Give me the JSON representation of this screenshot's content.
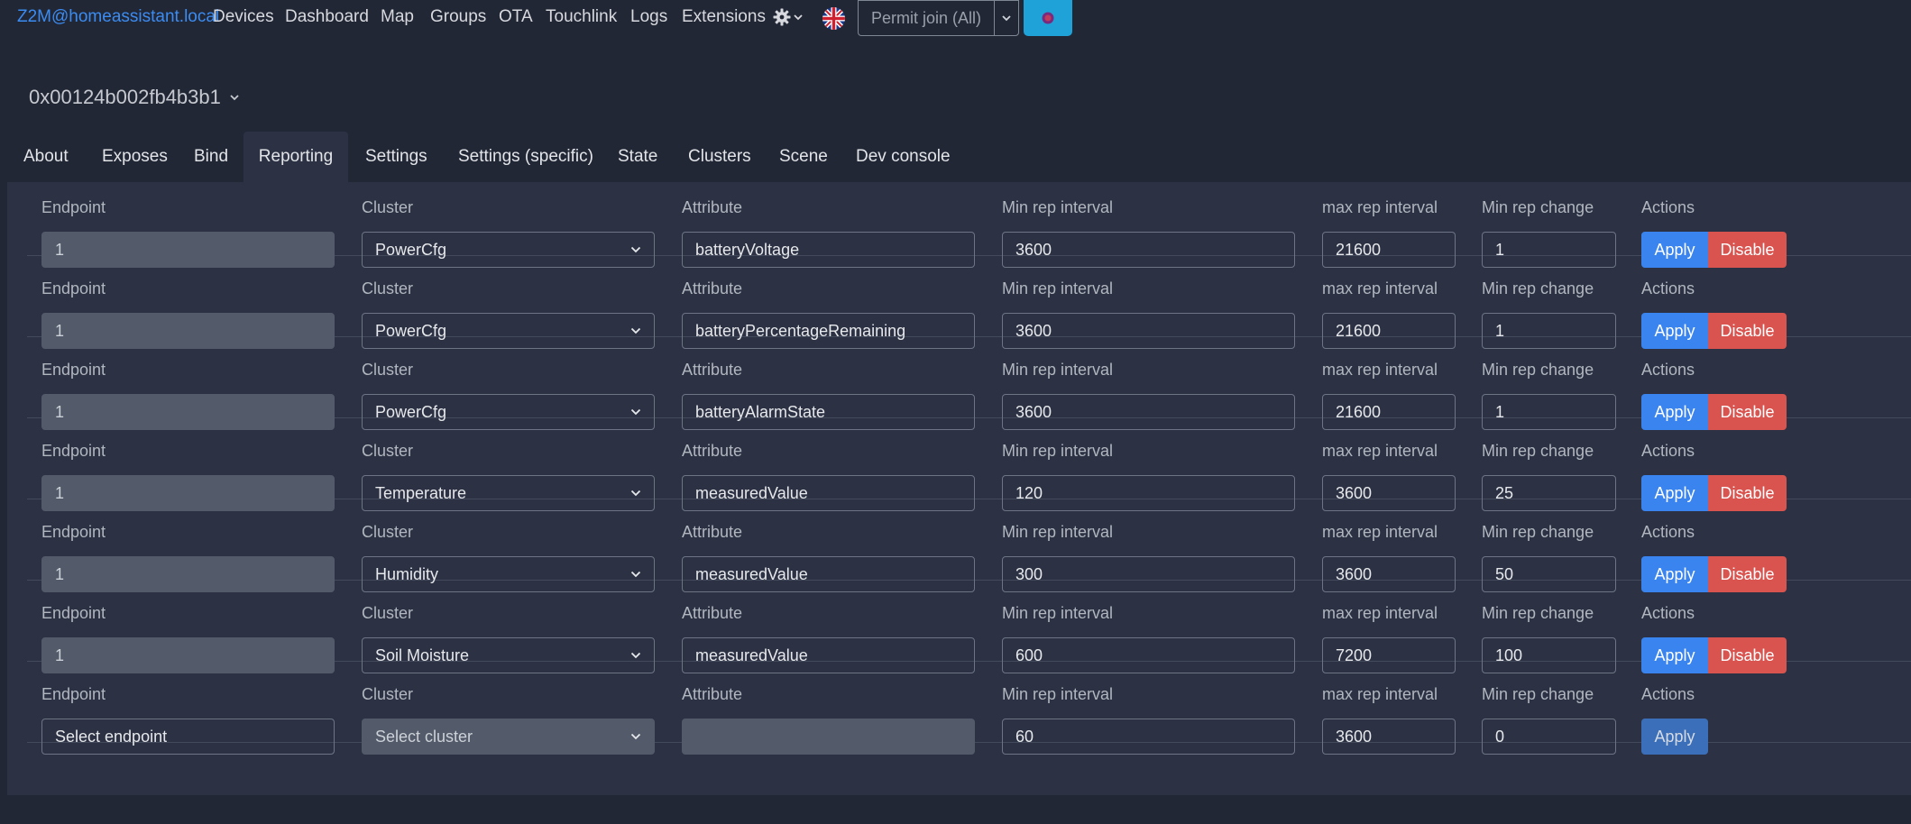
{
  "navbar": {
    "brand": "Z2M@homeassistant.local",
    "items": [
      "Devices",
      "Dashboard",
      "Map",
      "Groups",
      "OTA",
      "Touchlink",
      "Logs",
      "Extensions"
    ],
    "permit_join": "Permit join (All)"
  },
  "device": {
    "title": "0x00124b002fb4b3b1"
  },
  "tabs": [
    "About",
    "Exposes",
    "Bind",
    "Reporting",
    "Settings",
    "Settings (specific)",
    "State",
    "Clusters",
    "Scene",
    "Dev console"
  ],
  "active_tab": "Reporting",
  "labels": {
    "endpoint": "Endpoint",
    "cluster": "Cluster",
    "attribute": "Attribute",
    "min_interval": "Min rep interval",
    "max_interval": "max rep interval",
    "min_change": "Min rep change",
    "actions": "Actions",
    "apply": "Apply",
    "disable": "Disable"
  },
  "rows": [
    {
      "endpoint": "1",
      "cluster": "PowerCfg",
      "attribute": "batteryVoltage",
      "min_interval": "3600",
      "max_interval": "21600",
      "min_change": "1"
    },
    {
      "endpoint": "1",
      "cluster": "PowerCfg",
      "attribute": "batteryPercentageRemaining",
      "min_interval": "3600",
      "max_interval": "21600",
      "min_change": "1"
    },
    {
      "endpoint": "1",
      "cluster": "PowerCfg",
      "attribute": "batteryAlarmState",
      "min_interval": "3600",
      "max_interval": "21600",
      "min_change": "1"
    },
    {
      "endpoint": "1",
      "cluster": "Temperature",
      "attribute": "measuredValue",
      "min_interval": "120",
      "max_interval": "3600",
      "min_change": "25"
    },
    {
      "endpoint": "1",
      "cluster": "Humidity",
      "attribute": "measuredValue",
      "min_interval": "300",
      "max_interval": "3600",
      "min_change": "50"
    },
    {
      "endpoint": "1",
      "cluster": "Soil Moisture",
      "attribute": "measuredValue",
      "min_interval": "600",
      "max_interval": "7200",
      "min_change": "100"
    }
  ],
  "new_row": {
    "endpoint_placeholder": "Select endpoint",
    "cluster_placeholder": "Select cluster",
    "attribute": "",
    "min_interval": "60",
    "max_interval": "3600",
    "min_change": "0"
  },
  "colors": {
    "background": "#222736",
    "panel": "#2c3244",
    "brand": "#3b8cf2",
    "apply": "#3a84ef",
    "disable": "#d9534f",
    "accent_button": "#1fa2d8"
  },
  "icons": [
    "gear-icon",
    "chevron-down-icon",
    "uk-flag-icon",
    "caret-down-icon"
  ]
}
